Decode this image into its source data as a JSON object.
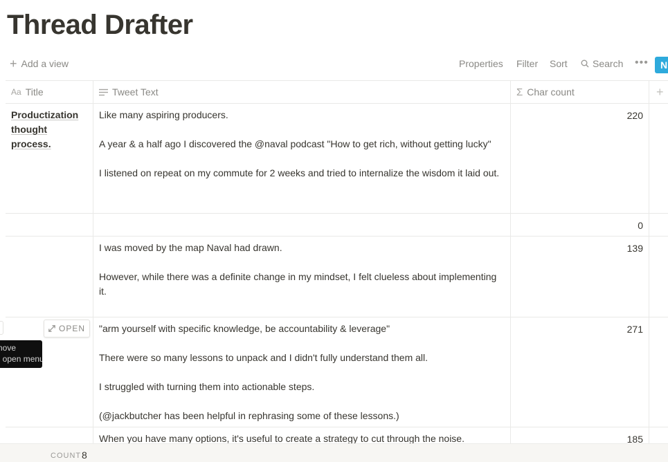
{
  "page": {
    "title": "Thread Drafter"
  },
  "toolbar": {
    "add_view": "Add a view",
    "properties": "Properties",
    "filter": "Filter",
    "sort": "Sort",
    "search": "Search",
    "more": "•••",
    "new_label": "N"
  },
  "columns": {
    "title": "Title",
    "tweet_text": "Tweet Text",
    "char_count": "Char count",
    "add": "+"
  },
  "rows": [
    {
      "title": "Productization thought process.",
      "tweet": "Like many aspiring producers.\n\nA year & a half ago I discovered the @naval podcast \"How to get rich, without getting lucky\"\n\nI listened on repeat on my commute for 2 weeks and tried to internalize the wisdom it laid out.",
      "count": "220"
    },
    {
      "title": "",
      "tweet": "",
      "count": "0"
    },
    {
      "title": "",
      "tweet": "I was moved by the map Naval had drawn.\n\nHowever, while there was a definite change in my mindset, I felt clueless about implementing it.",
      "count": "139"
    },
    {
      "title": "",
      "tweet": "\"arm yourself with specific knowledge, be accountability & leverage\"\n\nThere were so many lessons to unpack and I didn't fully understand them all.\n\nI struggled with turning them into actionable steps.\n\n(@jackbutcher has been helpful in rephrasing some of these lessons.)",
      "count": "271"
    },
    {
      "title": "",
      "tweet": "When you have many options, it's useful to create a strategy to cut through the noise.",
      "count": "185"
    }
  ],
  "row_actions": {
    "open": "OPEN"
  },
  "tooltip": {
    "line1": "Drag to move",
    "line2": "Click to open menu"
  },
  "footer": {
    "count_label": "COUNT",
    "count_value": "8"
  },
  "colors": {
    "accent": "#2eaadc",
    "text": "#37352f",
    "muted": "#8a8985",
    "border": "#e9e9e7"
  }
}
